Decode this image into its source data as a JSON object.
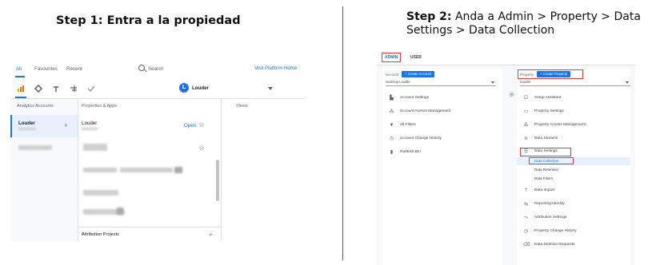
{
  "step1": {
    "title": "Step 1: Entra a la propiedad"
  },
  "step2": {
    "title_bold": "Step 2:",
    "title_rest": " Anda a  Admin > Property > Data Settings > Data Collection"
  },
  "left": {
    "tabs": [
      "All",
      "Favourites",
      "Recent"
    ],
    "search_label": "Search",
    "visit_link": "Visit Platform Home",
    "avatar_letter": "L",
    "selected_property": "Louder",
    "col_headers": [
      "Analytics Accounts",
      "Properties & Apps",
      "Views"
    ],
    "account_selected": "Louder",
    "property_row": "Louder",
    "open_label": "Open",
    "attribution_label": "Attribution Projects"
  },
  "right": {
    "tabs": {
      "admin": "ADMIN",
      "user": "USER"
    },
    "account": {
      "label": "Account",
      "create": "+ Create Account",
      "select_value": "Scott-up Louder",
      "items": [
        "Account Settings",
        "Account Access Management",
        "All Filters",
        "Account Change History",
        "Rubbish Bin"
      ]
    },
    "property": {
      "label": "Property",
      "create": "+ Create Property",
      "select_value": "Louder",
      "items": [
        "Setup Assistant",
        "Property Settings",
        "Property Access Management",
        "Data Streams",
        "Data Settings"
      ],
      "data_settings_sub": [
        "Data Collection",
        "Data Retention",
        "Data Filters"
      ],
      "items_after": [
        "Data Import",
        "Reporting Identity",
        "Attribution Settings",
        "Property Change History",
        "Data Deletion Requests"
      ]
    }
  },
  "colors": {
    "accent": "#1a73e8",
    "highlight": "#e53935"
  }
}
